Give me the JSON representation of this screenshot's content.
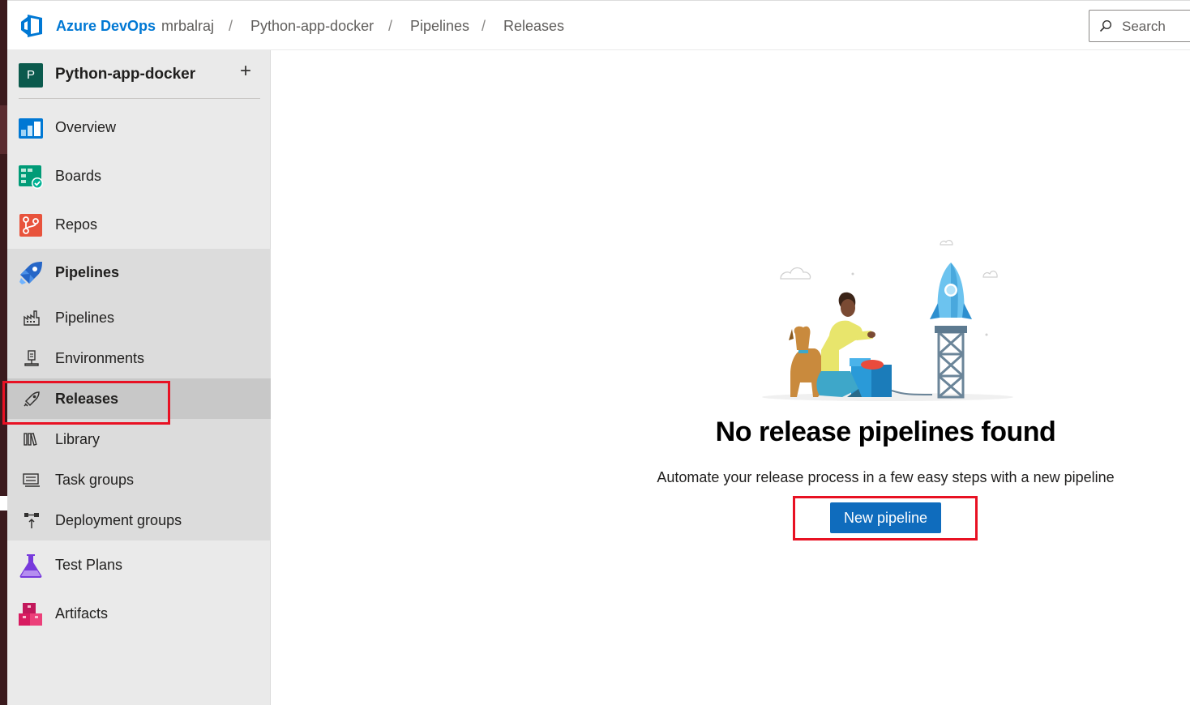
{
  "header": {
    "brand": "Azure DevOps",
    "breadcrumbs": [
      "mrbalraj",
      "Python-app-docker",
      "Pipelines",
      "Releases"
    ],
    "separator": "/",
    "search_placeholder": "Search"
  },
  "sidebar": {
    "project_initial": "P",
    "project_name": "Python-app-docker",
    "add_label": "+",
    "items": [
      {
        "label": "Overview",
        "icon": "overview-icon"
      },
      {
        "label": "Boards",
        "icon": "boards-icon"
      },
      {
        "label": "Repos",
        "icon": "repos-icon"
      },
      {
        "label": "Pipelines",
        "icon": "pipelines-icon"
      },
      {
        "label": "Test Plans",
        "icon": "test-plans-icon"
      },
      {
        "label": "Artifacts",
        "icon": "artifacts-icon"
      }
    ],
    "pipeline_sub_items": [
      {
        "label": "Pipelines",
        "icon": "pipelines-sub-icon"
      },
      {
        "label": "Environments",
        "icon": "environments-icon"
      },
      {
        "label": "Releases",
        "icon": "releases-icon",
        "selected": true
      },
      {
        "label": "Library",
        "icon": "library-icon"
      },
      {
        "label": "Task groups",
        "icon": "task-groups-icon"
      },
      {
        "label": "Deployment groups",
        "icon": "deployment-groups-icon"
      }
    ]
  },
  "main": {
    "empty_title": "No release pipelines found",
    "empty_description": "Automate your release process in a few easy steps with a new pipeline",
    "new_pipeline_label": "New pipeline"
  },
  "colors": {
    "brand_blue": "#0078d4",
    "button_blue": "#0f6cbd",
    "highlight_red": "#e81123",
    "sidebar_bg": "#eaeaea",
    "selected_bg": "#c8c8c8"
  }
}
